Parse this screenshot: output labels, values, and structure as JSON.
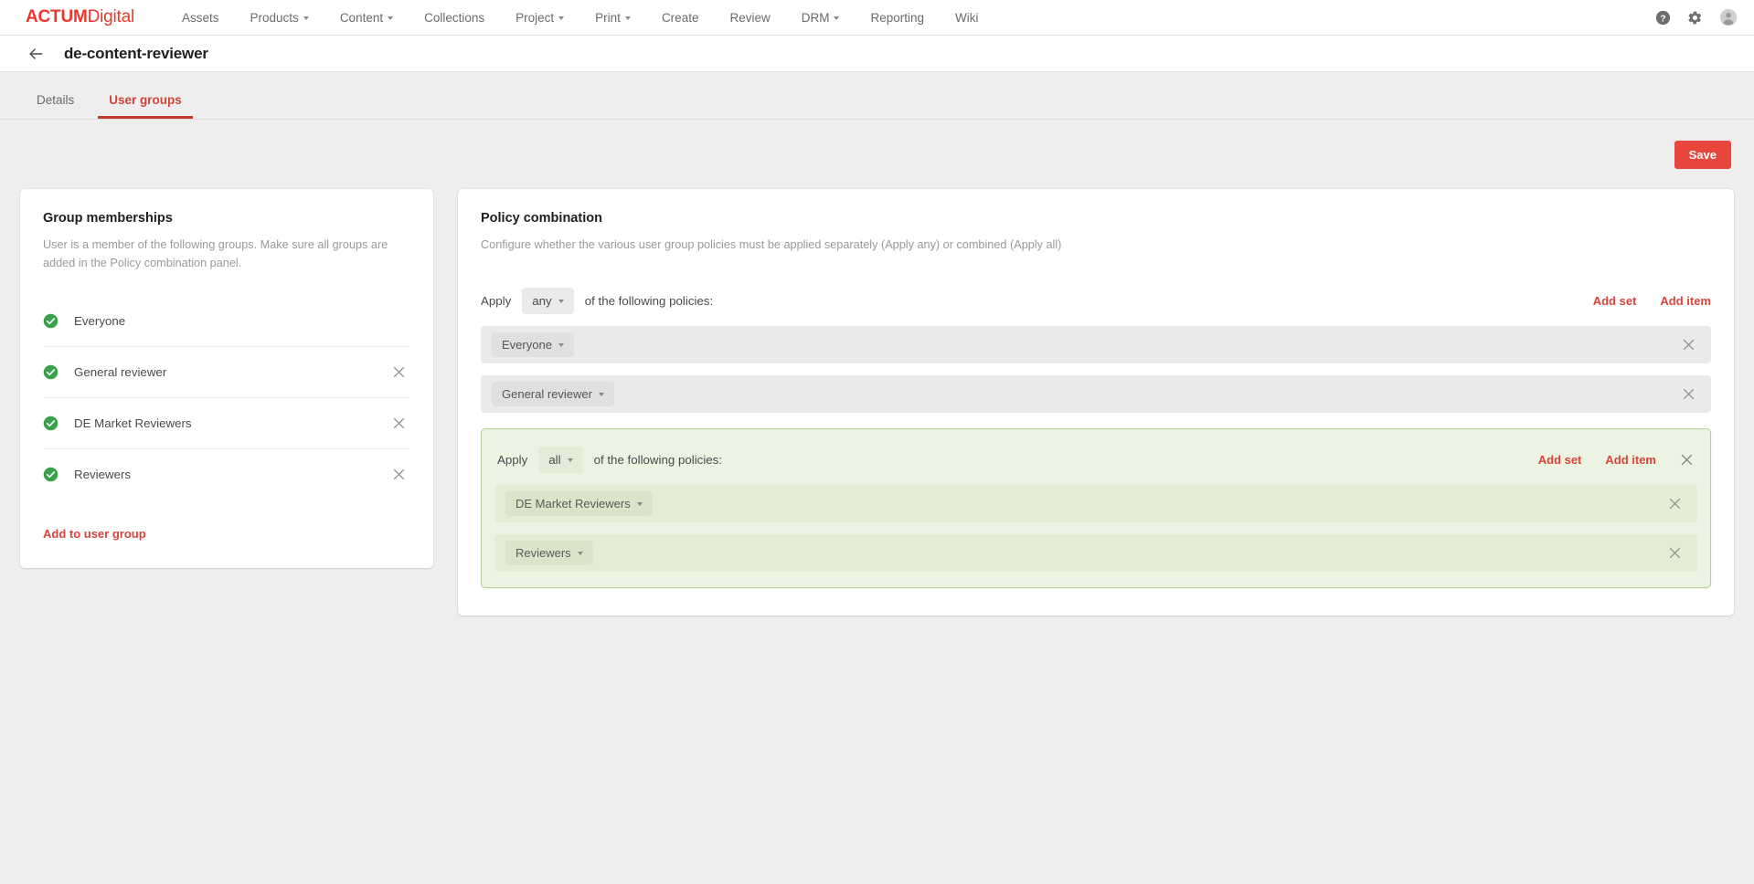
{
  "brand": {
    "bold": "ACTUM",
    "light": "Digital"
  },
  "topnav": {
    "items": [
      {
        "label": "Assets",
        "caret": false,
        "icon": ""
      },
      {
        "label": "Products",
        "caret": true,
        "icon": "chevron-down-icon"
      },
      {
        "label": "Content",
        "caret": true,
        "icon": "chevron-down-icon"
      },
      {
        "label": "Collections",
        "caret": false,
        "icon": ""
      },
      {
        "label": "Project",
        "caret": true,
        "icon": "chevron-down-icon"
      },
      {
        "label": "Print",
        "caret": true,
        "icon": "chevron-down-icon"
      },
      {
        "label": "Create",
        "caret": false,
        "icon": ""
      },
      {
        "label": "Review",
        "caret": false,
        "icon": ""
      },
      {
        "label": "DRM",
        "caret": true,
        "icon": "chevron-down-icon"
      },
      {
        "label": "Reporting",
        "caret": false,
        "icon": ""
      },
      {
        "label": "Wiki",
        "caret": false,
        "icon": ""
      }
    ],
    "right_icons": [
      "help-icon",
      "gear-icon",
      "user-avatar-icon"
    ]
  },
  "page_header": {
    "back_icon": "back-arrow-icon",
    "title": "de-content-reviewer"
  },
  "tabs": [
    {
      "label": "Details",
      "active": false
    },
    {
      "label": "User groups",
      "active": true
    }
  ],
  "toolbar": {
    "save_label": "Save"
  },
  "group_memberships": {
    "title": "Group memberships",
    "description": "User is a member of the following groups. Make sure all groups are added in the Policy combination panel.",
    "items": [
      {
        "name": "Everyone",
        "checked": true,
        "removable": false
      },
      {
        "name": "General reviewer",
        "checked": true,
        "removable": true
      },
      {
        "name": "DE Market Reviewers",
        "checked": true,
        "removable": true
      },
      {
        "name": "Reviewers",
        "checked": true,
        "removable": true
      }
    ],
    "add_link": "Add to user group"
  },
  "policy_combination": {
    "title": "Policy combination",
    "description": "Configure whether the various user group policies must be applied separately (Apply any) or combined (Apply all)",
    "apply_prefix": "Apply",
    "apply_value": "any",
    "apply_suffix": "of the following policies:",
    "add_set_label": "Add set",
    "add_item_label": "Add item",
    "items": [
      {
        "label": "Everyone"
      },
      {
        "label": "General reviewer"
      }
    ],
    "nested_set": {
      "apply_prefix": "Apply",
      "apply_value": "all",
      "apply_suffix": "of the following policies:",
      "add_set_label": "Add set",
      "add_item_label": "Add item",
      "items": [
        {
          "label": "DE Market Reviewers"
        },
        {
          "label": "Reviewers"
        }
      ]
    }
  },
  "colors": {
    "brand_red": "#e8392c",
    "accent_red": "#d6453c",
    "save_red": "#e8453c",
    "check_green": "#3aa14a",
    "set_border_green": "#b7cf96",
    "set_bg_green": "#edf3e3"
  }
}
